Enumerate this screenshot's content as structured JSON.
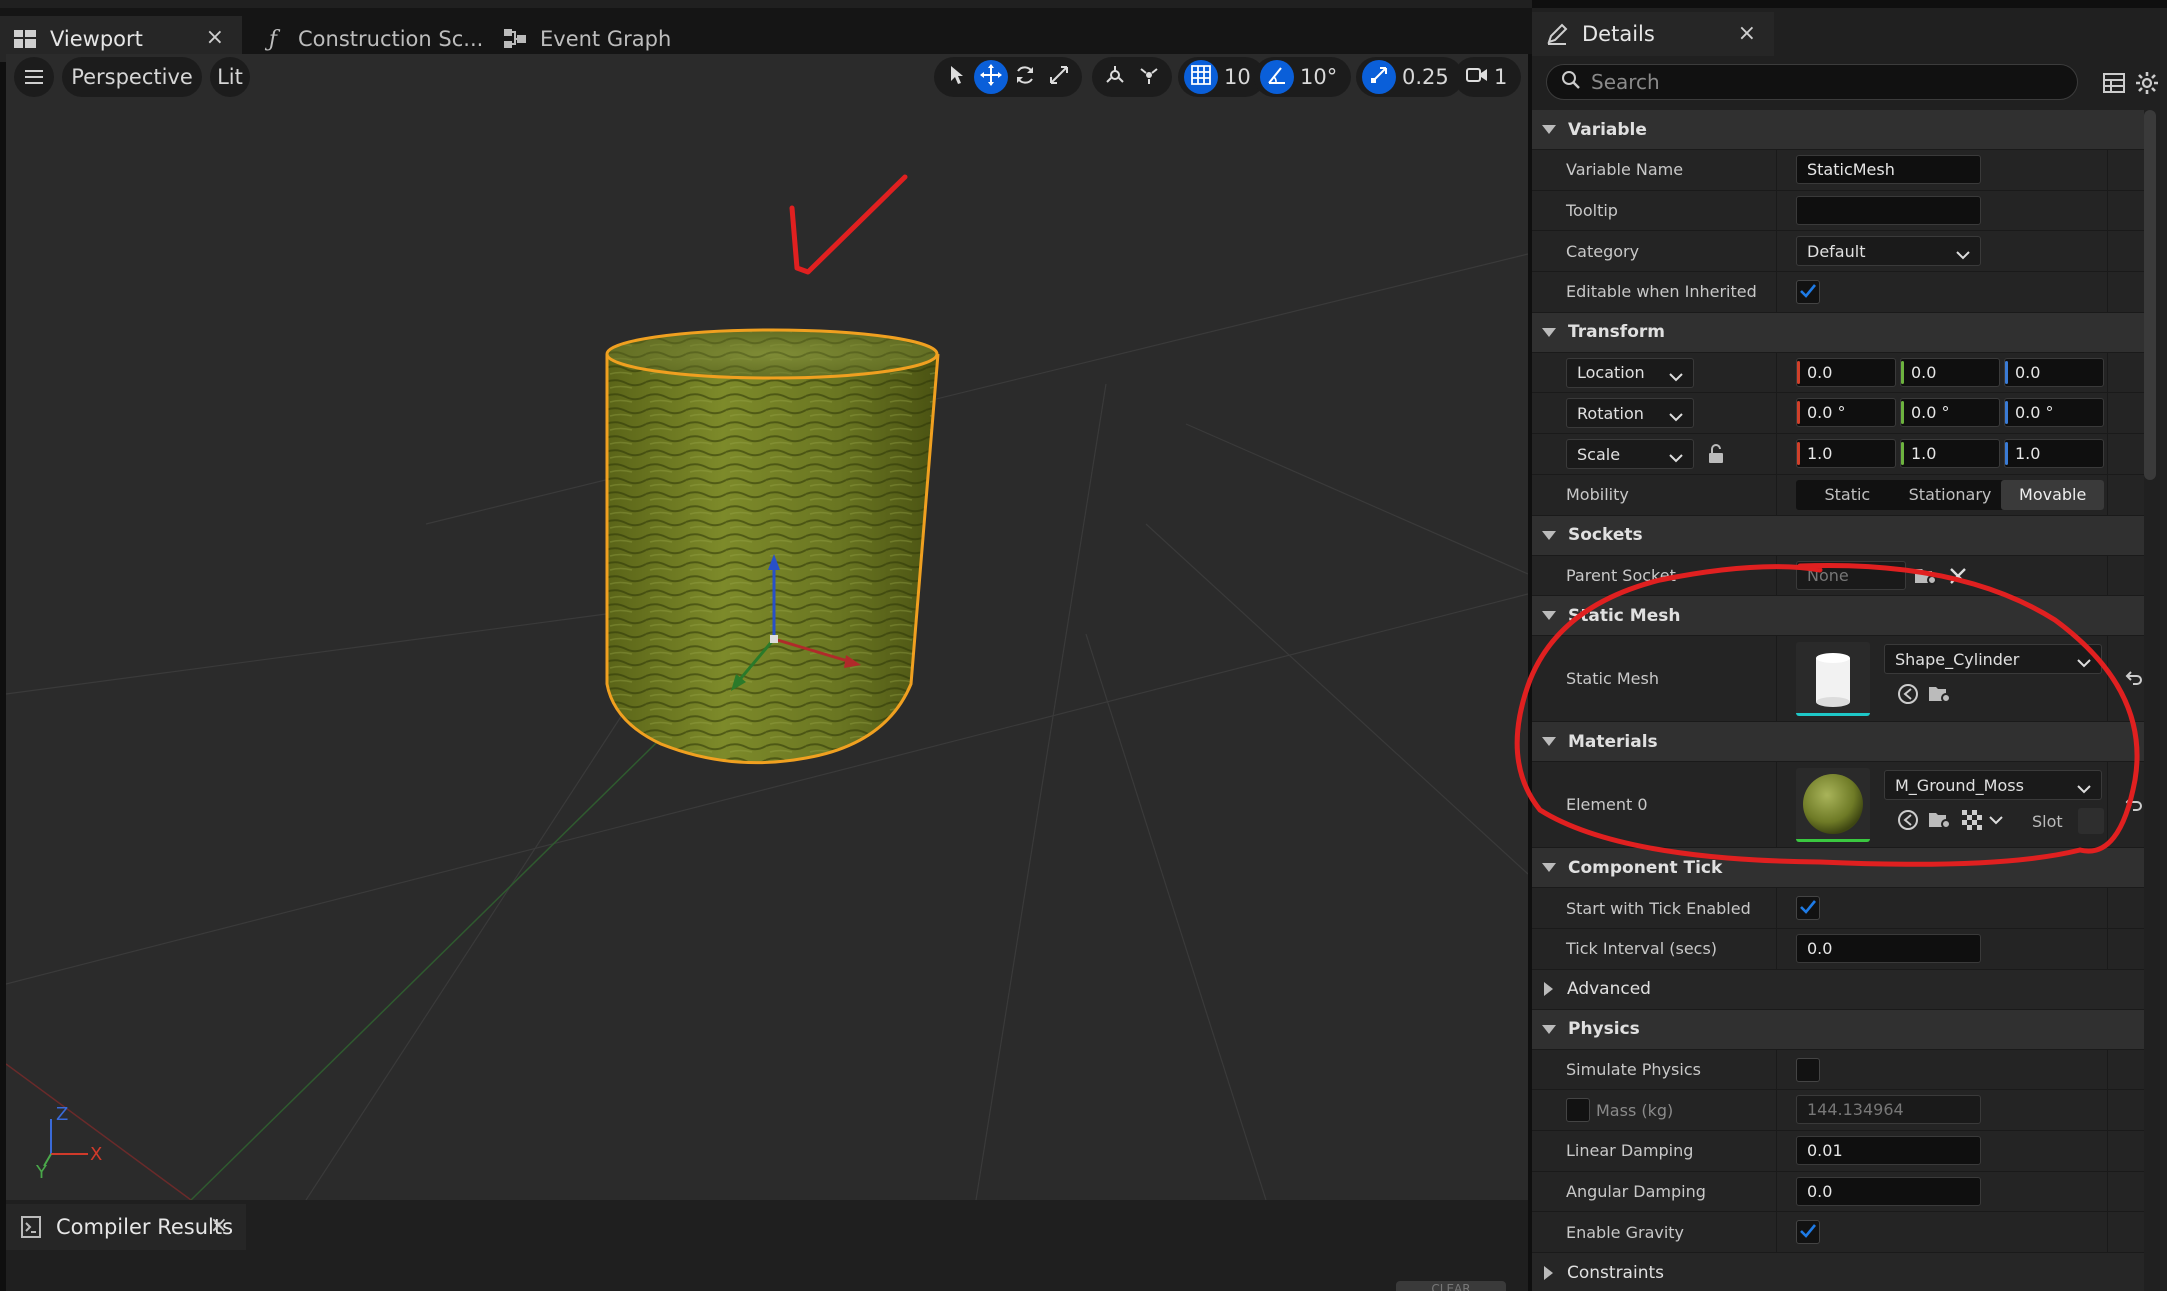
{
  "tabs": {
    "viewport": "Viewport",
    "construction": "Construction Sc...",
    "event_graph": "Event Graph",
    "details": "Details",
    "compiler_results": "Compiler Results",
    "close": "×"
  },
  "viewport_toolbar": {
    "perspective": "Perspective",
    "lit": "Lit",
    "grid_snap": "10",
    "rotation_snap": "10°",
    "scale_snap": "0.25",
    "camera_speed": "1"
  },
  "axis_gizmo": {
    "z": "Z",
    "x": "X",
    "y": "Y"
  },
  "compiler": {
    "clear_label": "CLEAR"
  },
  "details": {
    "search_placeholder": "Search",
    "categories": {
      "variable": "Variable",
      "transform": "Transform",
      "sockets": "Sockets",
      "static_mesh": "Static Mesh",
      "materials": "Materials",
      "component_tick": "Component Tick",
      "advanced": "Advanced",
      "physics": "Physics",
      "constraints": "Constraints"
    },
    "variable": {
      "name_label": "Variable Name",
      "name_value": "StaticMesh",
      "tooltip_label": "Tooltip",
      "tooltip_value": "",
      "category_label": "Category",
      "category_value": "Default",
      "editable_label": "Editable when Inherited"
    },
    "transform": {
      "location_label": "Location",
      "location": [
        "0.0",
        "0.0",
        "0.0"
      ],
      "rotation_label": "Rotation",
      "rotation": [
        "0.0 °",
        "0.0 °",
        "0.0 °"
      ],
      "scale_label": "Scale",
      "scale": [
        "1.0",
        "1.0",
        "1.0"
      ],
      "mobility_label": "Mobility",
      "mobility_options": [
        "Static",
        "Stationary",
        "Movable"
      ],
      "mobility_selected": "Movable"
    },
    "sockets": {
      "parent_label": "Parent Socket",
      "parent_value": "None"
    },
    "static_mesh": {
      "label": "Static Mesh",
      "value": "Shape_Cylinder"
    },
    "materials": {
      "element_label": "Element 0",
      "value": "M_Ground_Moss",
      "slot_label": "Slot"
    },
    "tick": {
      "start_label": "Start with Tick Enabled",
      "interval_label": "Tick Interval (secs)",
      "interval_value": "0.0"
    },
    "physics": {
      "simulate_label": "Simulate Physics",
      "mass_label": "Mass (kg)",
      "mass_value": "144.134964",
      "linear_label": "Linear Damping",
      "linear_value": "0.01",
      "angular_label": "Angular Damping",
      "angular_value": "0.0",
      "gravity_label": "Enable Gravity"
    }
  },
  "colors": {
    "accent": "#0a5fd9",
    "annotation": "#e02020",
    "selection_outline": "#f0a020"
  }
}
